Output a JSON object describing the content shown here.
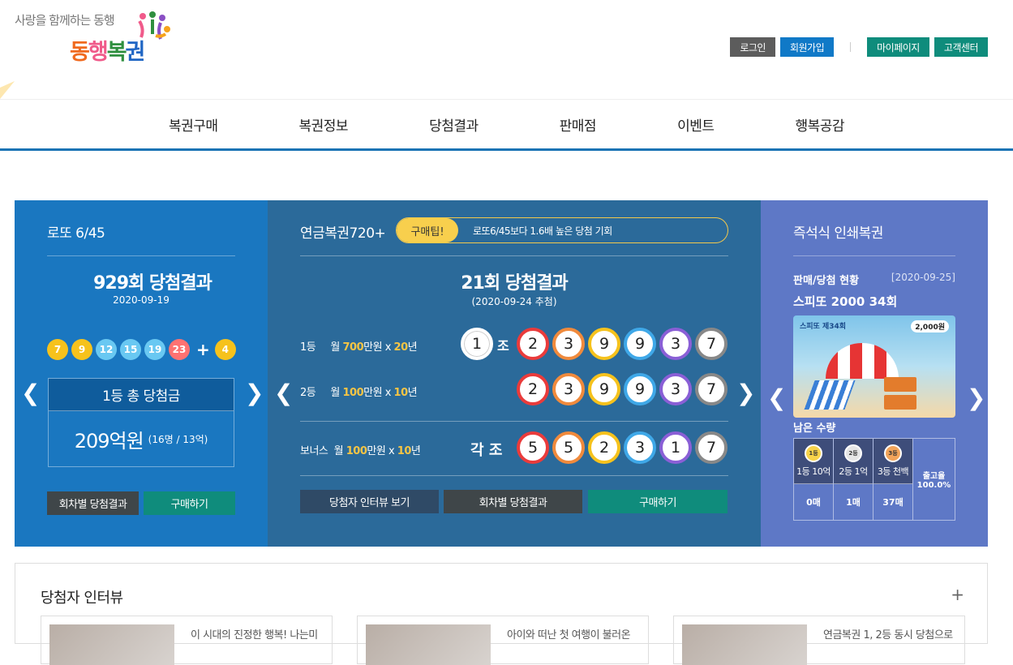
{
  "header": {
    "slogan": "사랑을 함께하는 동행",
    "logo_parts": [
      "동",
      "행",
      "복",
      "권"
    ],
    "links": {
      "login": "로그인",
      "join": "회원가입",
      "mypage": "마이페이지",
      "customer": "고객센터"
    }
  },
  "nav": [
    "복권구매",
    "복권정보",
    "당첨결과",
    "판매점",
    "이벤트",
    "행복공감"
  ],
  "lotto": {
    "title": "로또 6/45",
    "round_title": "929회 당첨결과",
    "date": "2020-09-19",
    "balls": [
      {
        "num": "7",
        "color": "#f6c21c"
      },
      {
        "num": "9",
        "color": "#f6c21c"
      },
      {
        "num": "12",
        "color": "#69c8f2"
      },
      {
        "num": "15",
        "color": "#69c8f2"
      },
      {
        "num": "19",
        "color": "#69c8f2"
      },
      {
        "num": "23",
        "color": "#ff7272"
      }
    ],
    "plus": "+",
    "bonus": {
      "num": "4",
      "color": "#f6c21c"
    },
    "prize_head": "1등 총 당첨금",
    "prize_amount": "209억원",
    "prize_detail": "(16명 / 13억)",
    "btn_history": "회차별 당첨결과",
    "btn_buy": "구매하기"
  },
  "pension": {
    "title": "연금복권720+",
    "tip_label": "구매팁!",
    "tip_text": "로또6/45보다 1.6배 높은 당첨 기회",
    "round_title": "21회 당첨결과",
    "date": "(2020-09-24 추첨)",
    "rank1": {
      "label": "1등",
      "pre": "월 ",
      "amount": "700",
      "mid": "만원 x ",
      "years": "20",
      "post": "년"
    },
    "rank2": {
      "label": "2등",
      "pre": "월 ",
      "amount": "100",
      "mid": "만원 x ",
      "years": "10",
      "post": "년"
    },
    "bonus": {
      "label": "보너스",
      "pre": "월 ",
      "amount": "100",
      "mid": "만원 x ",
      "years": "10",
      "post": "년"
    },
    "group_ball": "1",
    "group_unit": "조",
    "each_unit": "각 조",
    "win_numbers": [
      "2",
      "3",
      "9",
      "9",
      "3",
      "7"
    ],
    "bonus_numbers": [
      "5",
      "5",
      "2",
      "3",
      "1",
      "7"
    ],
    "ring_colors": [
      "#ea3b3b",
      "#f08a3c",
      "#f6c21c",
      "#3fa8e8",
      "#8a5fd6",
      "#888888"
    ],
    "btn_interview": "당첨자 인터뷰 보기",
    "btn_history": "회차별 당첨결과",
    "btn_buy": "구매하기"
  },
  "instant": {
    "title": "즉석식 인쇄복권",
    "sub_title": "판매/당첨 현황",
    "date": "[2020-09-25]",
    "product": "스피또 2000 34회",
    "ticket_title": "스피또 제34회",
    "ticket_price": "2,000원",
    "remain_label": "남은 수량",
    "tiers": [
      {
        "medal": "1등",
        "name": "1등 10억",
        "count": "0매"
      },
      {
        "medal": "2등",
        "name": "2등 1억",
        "count": "1매"
      },
      {
        "medal": "3등",
        "name": "3등 천백",
        "count": "37매"
      }
    ],
    "rate_label": "출고율",
    "rate_value": "100.0%"
  },
  "interview": {
    "title": "당첨자 인터뷰",
    "plus": "+",
    "cards": [
      "이 시대의 진정한 행복! 나는미",
      "아이와 떠난 첫 여행이 불러온",
      "연금복권 1, 2등 동시 당첨으로"
    ]
  },
  "arrows": {
    "left": "❮",
    "right": "❯"
  }
}
